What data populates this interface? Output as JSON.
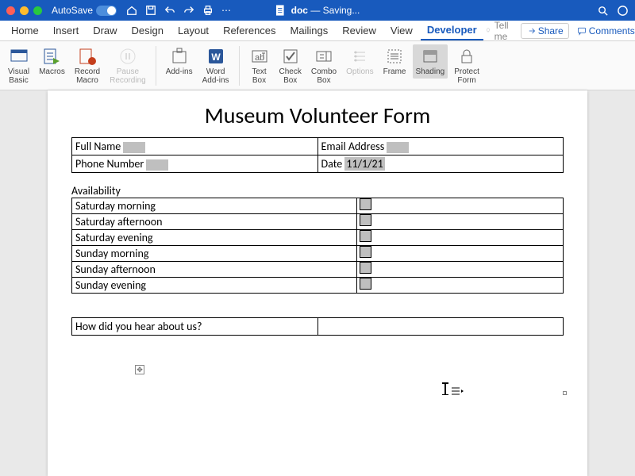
{
  "titlebar": {
    "autosave_label": "AutoSave",
    "autosave_state": "ON",
    "doc_name": "doc",
    "status": "Saving..."
  },
  "tabs": {
    "items": [
      "Home",
      "Insert",
      "Draw",
      "Design",
      "Layout",
      "References",
      "Mailings",
      "Review",
      "View",
      "Developer"
    ],
    "active_index": 9,
    "tell_me": "Tell me",
    "share": "Share",
    "comments": "Comments"
  },
  "ribbon": {
    "visual_basic": "Visual\nBasic",
    "macros": "Macros",
    "record_macro": "Record\nMacro",
    "pause_recording": "Pause\nRecording",
    "add_ins": "Add-ins",
    "word_add_ins": "Word\nAdd-ins",
    "text_box": "Text\nBox",
    "check_box": "Check\nBox",
    "combo_box": "Combo\nBox",
    "options": "Options",
    "frame": "Frame",
    "shading": "Shading",
    "protect_form": "Protect\nForm"
  },
  "document": {
    "title": "Museum Volunteer Form",
    "contact": {
      "full_name_label": "Full Name",
      "email_label": "Email Address",
      "phone_label": "Phone Number",
      "date_label": "Date",
      "date_value": "11/1/21"
    },
    "availability": {
      "heading": "Availability",
      "rows": [
        "Saturday morning",
        "Saturday afternoon",
        "Saturday evening",
        "Sunday morning",
        "Sunday afternoon",
        "Sunday evening"
      ]
    },
    "hear": {
      "label": "How did you hear about us?"
    }
  }
}
